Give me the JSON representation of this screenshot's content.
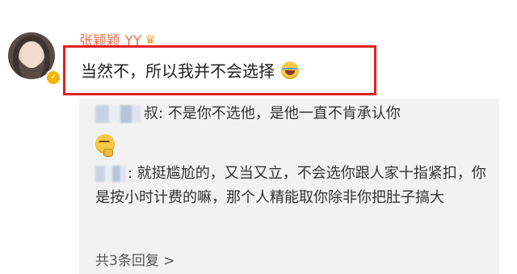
{
  "comment": {
    "username": "张颖颖 YY",
    "username_color": "#eb7350",
    "badge_icon": "crown-icon",
    "verified_icon": "verified-badge-icon",
    "text": "当然不，所以我并不会选择",
    "emoji": "laugh-cry-emoji"
  },
  "replies": {
    "items": [
      {
        "author_blurred": true,
        "text": "叔: 不是你不选他，是他一直不肯承认你"
      },
      {
        "author_blurred": true,
        "text": ": 就挺尴尬的，又当又立，不会选你跟人家十指紧扣，你是按小时计费的嘛，那个人精能取你除非你把肚子搞大"
      }
    ],
    "emoji_between": "thinking-emoji",
    "more_label": "共3条回复 >"
  },
  "highlight_color": "#e02020"
}
